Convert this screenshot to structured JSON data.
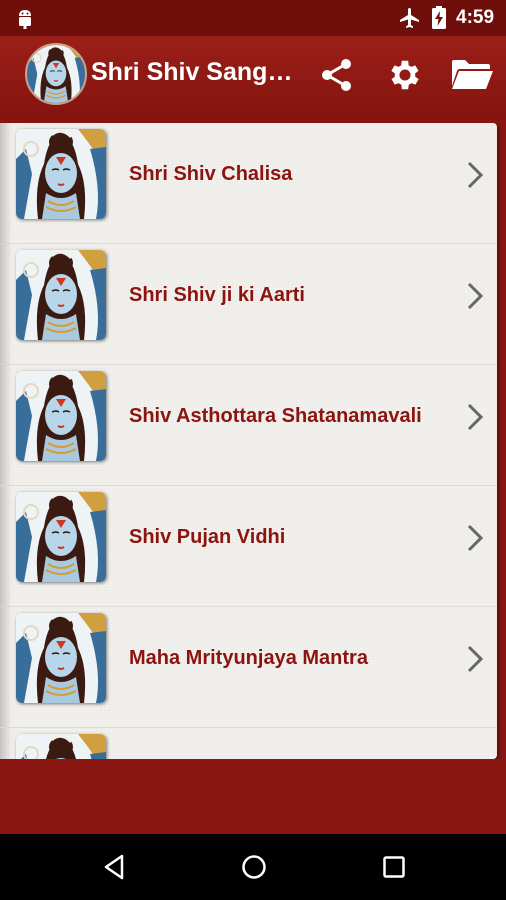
{
  "status_bar": {
    "time": "4:59",
    "icons": [
      "android-icon",
      "airplane-mode-icon",
      "battery-icon"
    ]
  },
  "app_bar": {
    "title": "Shri Shiv Sangrah",
    "actions": [
      "share-icon",
      "settings-gear-icon",
      "folder-icon"
    ]
  },
  "list": {
    "items": [
      {
        "label": "Shri Shiv Chalisa"
      },
      {
        "label": "Shri Shiv ji ki Aarti"
      },
      {
        "label": "Shiv Asthottara Shatanamavali"
      },
      {
        "label": "Shiv Pujan Vidhi"
      },
      {
        "label": "Maha Mrityunjaya Mantra"
      },
      {
        "label": ""
      }
    ]
  },
  "nav_bar": {
    "buttons": [
      "back-icon",
      "home-icon",
      "recent-apps-icon"
    ]
  },
  "colors": {
    "app_bar": "#9b1f18",
    "status_bar": "#6e0f0b",
    "list_text": "#8b1410",
    "background": "#8a1712",
    "paper": "#f2f0ec"
  }
}
